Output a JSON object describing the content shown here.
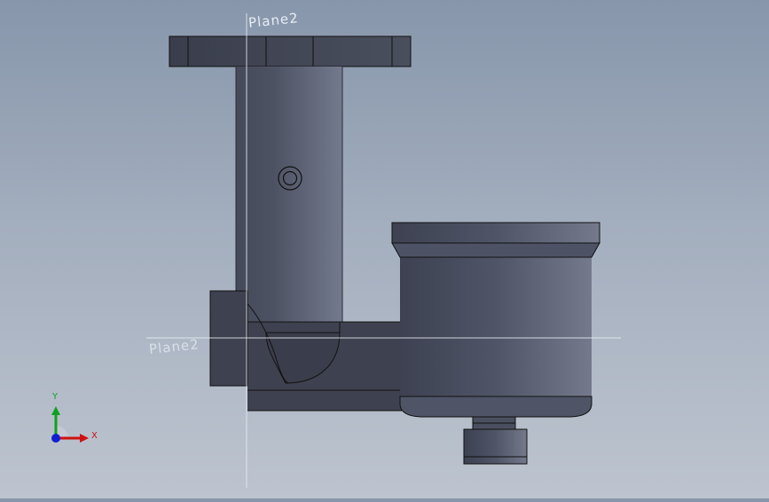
{
  "viewport": {
    "planes": {
      "top": "Plane2",
      "front": "Plane2"
    },
    "triad": {
      "x_label": "X",
      "y_label": "Y",
      "colors": {
        "x": "#d01010",
        "y": "#10a020",
        "z": "#1020d0"
      }
    }
  }
}
